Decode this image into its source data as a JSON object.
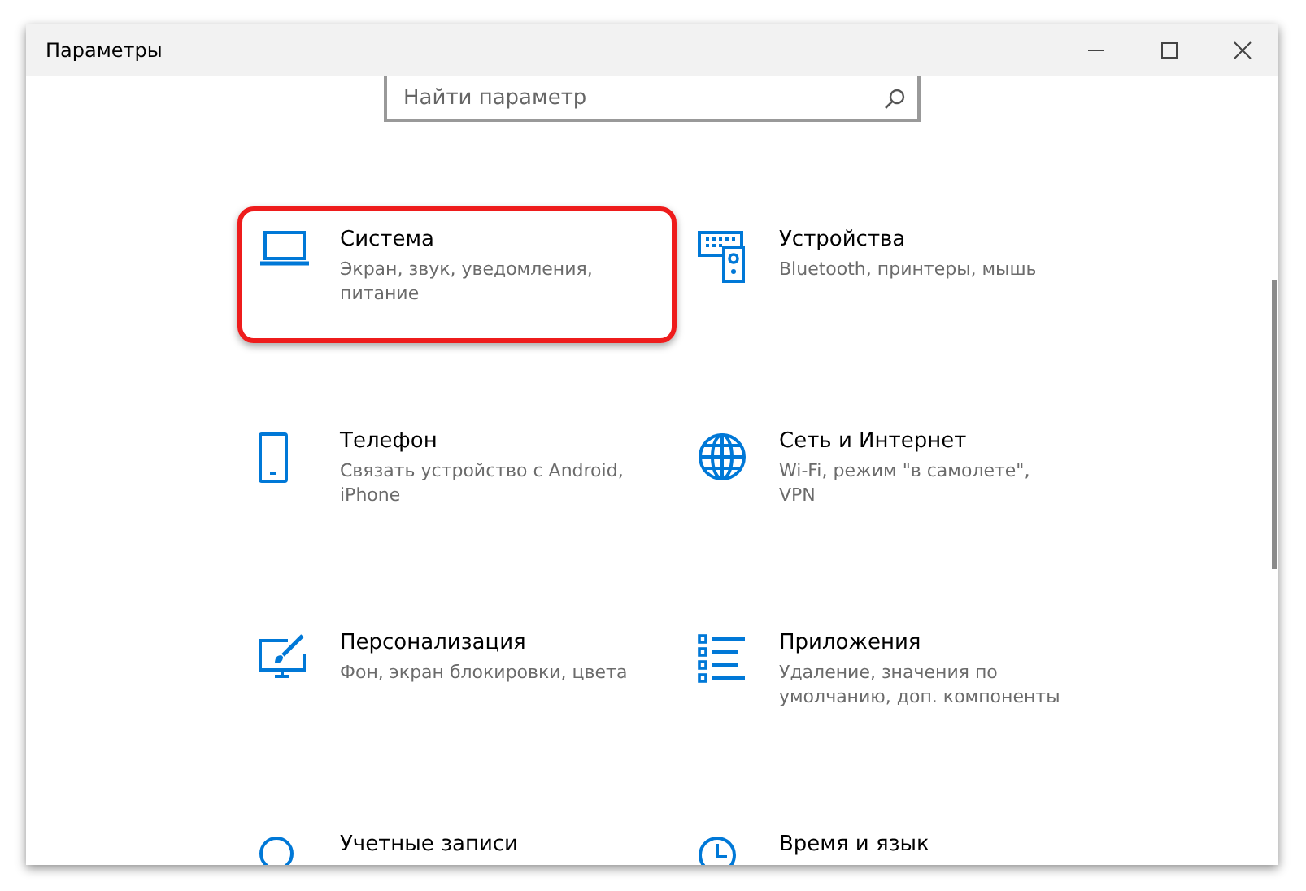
{
  "window": {
    "title": "Параметры"
  },
  "search": {
    "placeholder": "Найти параметр"
  },
  "tiles": [
    {
      "title": "Система",
      "description": "Экран, звук, уведомления, питание",
      "highlighted": true
    },
    {
      "title": "Устройства",
      "description": "Bluetooth, принтеры, мышь",
      "highlighted": false
    },
    {
      "title": "Телефон",
      "description": "Связать устройство с Android, iPhone",
      "highlighted": false
    },
    {
      "title": "Сеть и Интернет",
      "description": "Wi-Fi, режим \"в самолете\", VPN",
      "highlighted": false
    },
    {
      "title": "Персонализация",
      "description": "Фон, экран блокировки, цвета",
      "highlighted": false
    },
    {
      "title": "Приложения",
      "description": "Удаление, значения по умолчанию, доп. компоненты",
      "highlighted": false
    },
    {
      "title": "Учетные записи",
      "highlighted": false
    },
    {
      "title": "Время и язык",
      "highlighted": false
    }
  ]
}
